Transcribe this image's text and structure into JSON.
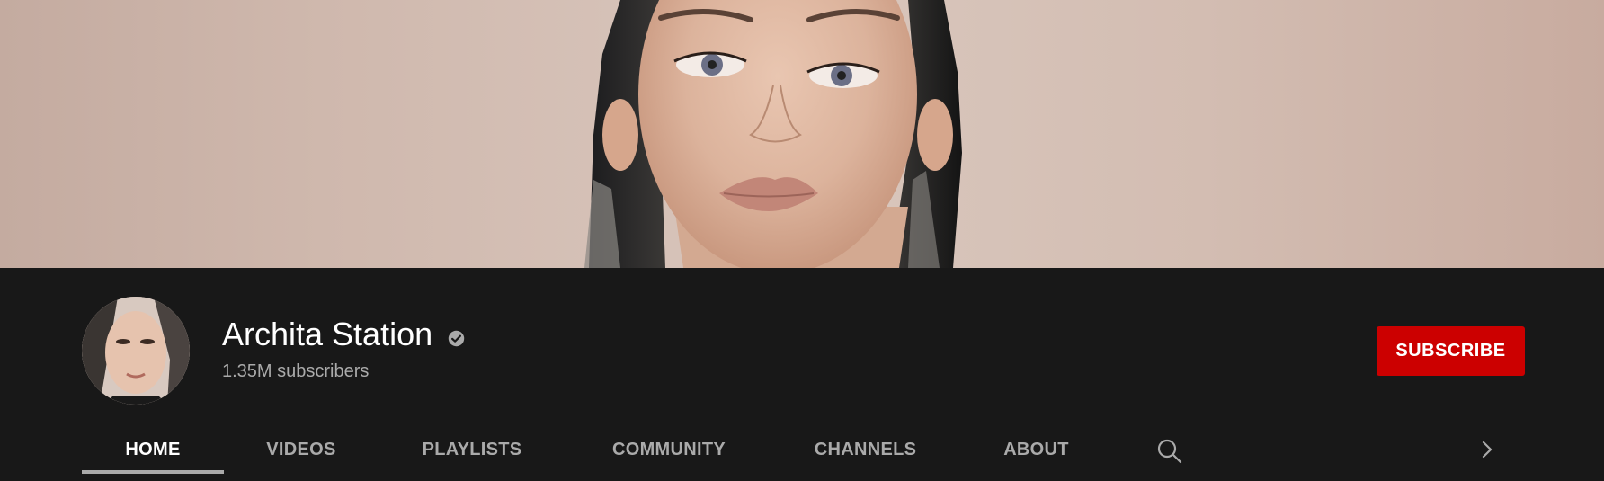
{
  "banner": {
    "image_description_icon": "banner-portrait-image"
  },
  "channel": {
    "name": "Archita Station",
    "verified_icon": "verified-check-icon",
    "subscribers": "1.35M subscribers",
    "avatar_icon": "avatar"
  },
  "actions": {
    "subscribe_label": "SUBSCRIBE"
  },
  "tabs": [
    {
      "label": "HOME",
      "active": true
    },
    {
      "label": "VIDEOS",
      "active": false
    },
    {
      "label": "PLAYLISTS",
      "active": false
    },
    {
      "label": "COMMUNITY",
      "active": false
    },
    {
      "label": "CHANNELS",
      "active": false
    },
    {
      "label": "ABOUT",
      "active": false
    }
  ],
  "icons": {
    "search": "search-icon",
    "next": "chevron-right-icon"
  },
  "colors": {
    "background": "#181818",
    "subscribe": "#cc0000",
    "text_primary": "#ffffff",
    "text_secondary": "#aaaaaa"
  }
}
